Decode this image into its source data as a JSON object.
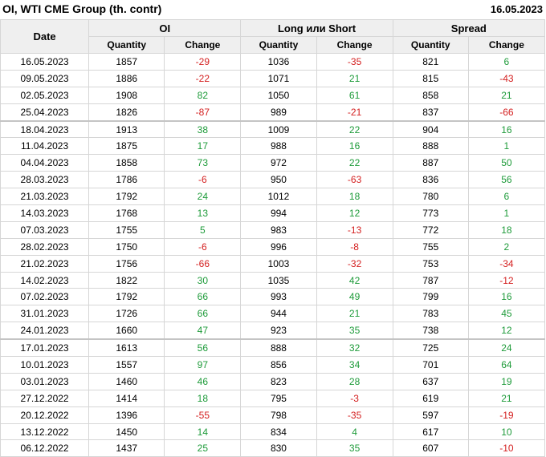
{
  "header": {
    "title": "OI, WTI CME Group (th. contr)",
    "date": "16.05.2023"
  },
  "table": {
    "columns": {
      "date": "Date",
      "oi": "OI",
      "long_short": "Long или Short",
      "spread": "Spread"
    },
    "sub": {
      "quantity": "Quantity",
      "change": "Change"
    },
    "rows": [
      [
        "16.05.2023",
        "1857",
        "-29",
        "1036",
        "-35",
        "821",
        "6"
      ],
      [
        "09.05.2023",
        "1886",
        "-22",
        "1071",
        "21",
        "815",
        "-43"
      ],
      [
        "02.05.2023",
        "1908",
        "82",
        "1050",
        "61",
        "858",
        "21"
      ],
      [
        "25.04.2023",
        "1826",
        "-87",
        "989",
        "-21",
        "837",
        "-66"
      ],
      [
        "18.04.2023",
        "1913",
        "38",
        "1009",
        "22",
        "904",
        "16"
      ],
      [
        "11.04.2023",
        "1875",
        "17",
        "988",
        "16",
        "888",
        "1"
      ],
      [
        "04.04.2023",
        "1858",
        "73",
        "972",
        "22",
        "887",
        "50"
      ],
      [
        "28.03.2023",
        "1786",
        "-6",
        "950",
        "-63",
        "836",
        "56"
      ],
      [
        "21.03.2023",
        "1792",
        "24",
        "1012",
        "18",
        "780",
        "6"
      ],
      [
        "14.03.2023",
        "1768",
        "13",
        "994",
        "12",
        "773",
        "1"
      ],
      [
        "07.03.2023",
        "1755",
        "5",
        "983",
        "-13",
        "772",
        "18"
      ],
      [
        "28.02.2023",
        "1750",
        "-6",
        "996",
        "-8",
        "755",
        "2"
      ],
      [
        "21.02.2023",
        "1756",
        "-66",
        "1003",
        "-32",
        "753",
        "-34"
      ],
      [
        "14.02.2023",
        "1822",
        "30",
        "1035",
        "42",
        "787",
        "-12"
      ],
      [
        "07.02.2023",
        "1792",
        "66",
        "993",
        "49",
        "799",
        "16"
      ],
      [
        "31.01.2023",
        "1726",
        "66",
        "944",
        "21",
        "783",
        "45"
      ],
      [
        "24.01.2023",
        "1660",
        "47",
        "923",
        "35",
        "738",
        "12"
      ],
      [
        "17.01.2023",
        "1613",
        "56",
        "888",
        "32",
        "725",
        "24"
      ],
      [
        "10.01.2023",
        "1557",
        "97",
        "856",
        "34",
        "701",
        "64"
      ],
      [
        "03.01.2023",
        "1460",
        "46",
        "823",
        "28",
        "637",
        "19"
      ],
      [
        "27.12.2022",
        "1414",
        "18",
        "795",
        "-3",
        "619",
        "21"
      ],
      [
        "20.12.2022",
        "1396",
        "-55",
        "798",
        "-35",
        "597",
        "-19"
      ],
      [
        "13.12.2022",
        "1450",
        "14",
        "834",
        "4",
        "617",
        "10"
      ],
      [
        "06.12.2022",
        "1437",
        "25",
        "830",
        "35",
        "607",
        "-10"
      ]
    ]
  },
  "colors": {
    "positive": "#1e9b3a",
    "negative": "#d42020",
    "header_bg": "#efefef",
    "border": "#d6d6d6"
  }
}
